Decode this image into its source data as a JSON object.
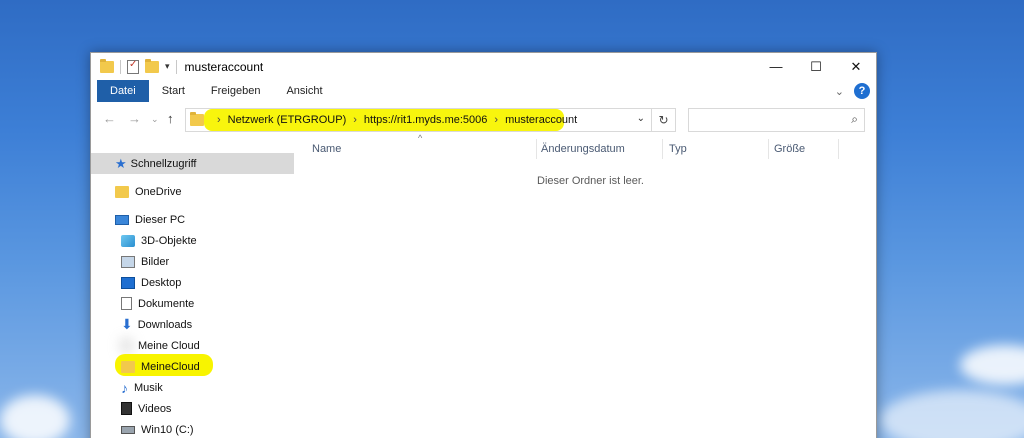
{
  "window": {
    "title": "musteraccount"
  },
  "window_controls": {
    "minimize": "—",
    "maximize": "☐",
    "close": "✕"
  },
  "ribbon": {
    "tabs": [
      "Datei",
      "Start",
      "Freigeben",
      "Ansicht"
    ],
    "help": "?"
  },
  "address": {
    "crumbs": [
      "Netzwerk (ETRGROUP)",
      "https://rit1.myds.me:5006",
      "musteraccount"
    ],
    "search_placeholder": ""
  },
  "sidebar": {
    "items": [
      {
        "label": "Schnellzugriff",
        "icon": "star-icon"
      },
      {
        "label": "OneDrive",
        "icon": "folder-icon"
      },
      {
        "label": "Dieser PC",
        "icon": "pc-icon"
      },
      {
        "label": "3D-Objekte",
        "icon": "cube-icon"
      },
      {
        "label": "Bilder",
        "icon": "pictures-icon"
      },
      {
        "label": "Desktop",
        "icon": "desktop-icon"
      },
      {
        "label": "Dokumente",
        "icon": "documents-icon"
      },
      {
        "label": "Downloads",
        "icon": "download-icon"
      },
      {
        "label": "Meine Cloud",
        "icon": "cloud-drive-icon"
      },
      {
        "label": "MeineCloud",
        "icon": "folder-icon"
      },
      {
        "label": "Musik",
        "icon": "music-icon"
      },
      {
        "label": "Videos",
        "icon": "video-icon"
      },
      {
        "label": "Win10 (C:)",
        "icon": "drive-icon"
      }
    ]
  },
  "columns": [
    "Name",
    "Änderungsdatum",
    "Typ",
    "Größe"
  ],
  "empty_message": "Dieser Ordner ist leer.",
  "colors": {
    "highlight": "#f8f400",
    "file_tab": "#1f5fa8",
    "selected_nav": "#d9d9d9"
  }
}
